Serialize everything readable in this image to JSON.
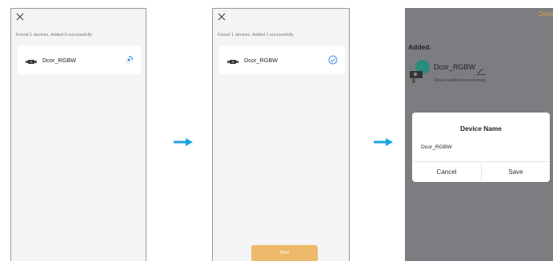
{
  "steps": [
    {
      "found_text": "Found 1 devices. Added 0 successfully.",
      "device_name": "Dcor_RGBW",
      "status": "adding"
    },
    {
      "found_text": "Found 1 devices. Added 1 successfully.",
      "device_name": "Dcor_RGBW",
      "status": "added",
      "next_label": "Next"
    },
    {
      "done_label": "Done",
      "added_title": "Added.",
      "device_name": "Dcor_RGBW",
      "device_subtitle": "Device added successfully",
      "dialog": {
        "title": "Device Name",
        "input_value": "Dcor_RGBW",
        "cancel_label": "Cancel",
        "save_label": "Save"
      }
    }
  ],
  "colors": {
    "accent_orange": "#ecb96a",
    "arrow_blue": "#1aa5e0",
    "check_blue": "#4a8fe8",
    "overlay_gray": "#7b7d80"
  },
  "icons": [
    "close-icon",
    "device-icon",
    "loading-icon",
    "check-circle-icon",
    "arrow-right-icon",
    "bulb-icon",
    "edit-icon"
  ]
}
